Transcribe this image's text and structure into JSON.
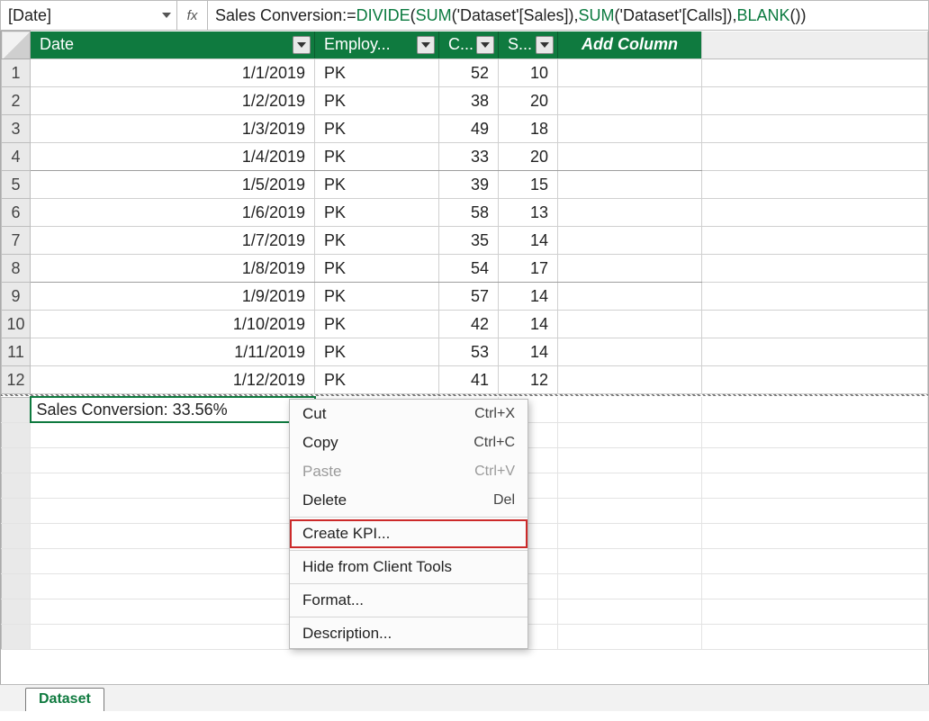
{
  "name_box": "[Date]",
  "fx_label": "fx",
  "formula": {
    "prefix": "Sales Conversion:=",
    "fn1": "DIVIDE",
    "open1": "(",
    "fn2": "SUM",
    "arg2": "('Dataset'[Sales]),",
    "fn3": "SUM",
    "arg3": "('Dataset'[Calls]),",
    "fn4": "BLANK",
    "close": "())"
  },
  "columns": {
    "date": "Date",
    "employ": "Employ...",
    "c": "C...",
    "s": "S...",
    "add": "Add Column"
  },
  "rows": [
    {
      "n": "1",
      "date": "1/1/2019",
      "emp": "PK",
      "c": "52",
      "s": "10"
    },
    {
      "n": "2",
      "date": "1/2/2019",
      "emp": "PK",
      "c": "38",
      "s": "20"
    },
    {
      "n": "3",
      "date": "1/3/2019",
      "emp": "PK",
      "c": "49",
      "s": "18"
    },
    {
      "n": "4",
      "date": "1/4/2019",
      "emp": "PK",
      "c": "33",
      "s": "20"
    },
    {
      "n": "5",
      "date": "1/5/2019",
      "emp": "PK",
      "c": "39",
      "s": "15"
    },
    {
      "n": "6",
      "date": "1/6/2019",
      "emp": "PK",
      "c": "58",
      "s": "13"
    },
    {
      "n": "7",
      "date": "1/7/2019",
      "emp": "PK",
      "c": "35",
      "s": "14"
    },
    {
      "n": "8",
      "date": "1/8/2019",
      "emp": "PK",
      "c": "54",
      "s": "17"
    },
    {
      "n": "9",
      "date": "1/9/2019",
      "emp": "PK",
      "c": "57",
      "s": "14"
    },
    {
      "n": "10",
      "date": "1/10/2019",
      "emp": "PK",
      "c": "42",
      "s": "14"
    },
    {
      "n": "11",
      "date": "1/11/2019",
      "emp": "PK",
      "c": "53",
      "s": "14"
    },
    {
      "n": "12",
      "date": "1/12/2019",
      "emp": "PK",
      "c": "41",
      "s": "12"
    }
  ],
  "measure_cell": "Sales Conversion: 33.56%",
  "context_menu": [
    {
      "label": "Cut",
      "shortcut": "Ctrl+X",
      "disabled": false
    },
    {
      "label": "Copy",
      "shortcut": "Ctrl+C",
      "disabled": false
    },
    {
      "label": "Paste",
      "shortcut": "Ctrl+V",
      "disabled": true
    },
    {
      "label": "Delete",
      "shortcut": "Del",
      "disabled": false
    },
    {
      "sep": true
    },
    {
      "label": "Create KPI...",
      "shortcut": "",
      "disabled": false,
      "highlight": true
    },
    {
      "sep": true
    },
    {
      "label": "Hide from Client Tools",
      "shortcut": "",
      "disabled": false
    },
    {
      "sep": true
    },
    {
      "label": "Format...",
      "shortcut": "",
      "disabled": false
    },
    {
      "sep": true
    },
    {
      "label": "Description...",
      "shortcut": "",
      "disabled": false
    }
  ],
  "sheet_tab": "Dataset"
}
